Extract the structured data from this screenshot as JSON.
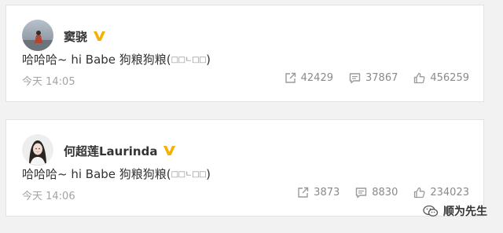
{
  "posts": [
    {
      "author": "窦骁",
      "text_main": "哈哈哈~ hi Babe 狗粮狗粮(",
      "text_emoticon": "□□ㄴ□□",
      "text_close": ")",
      "timestamp": "今天 14:05",
      "reposts": "42429",
      "comments": "37867",
      "likes": "456259"
    },
    {
      "author": "何超莲Laurinda",
      "text_main": "哈哈哈~ hi Babe 狗粮狗粮(",
      "text_emoticon": "□□ㄴ□□",
      "text_close": ")",
      "timestamp": "今天 14:06",
      "reposts": "3873",
      "comments": "8830",
      "likes": "234023"
    }
  ],
  "watermark": {
    "text": "顺为先生",
    "icon": "wechat-icon"
  },
  "icons": {
    "verified": "verified-badge-icon",
    "repost": "repost-icon",
    "comment": "comment-icon",
    "like": "like-icon"
  },
  "colors": {
    "verified_gold": "#f5b100",
    "text": "#333333",
    "meta": "#8a8a8a"
  }
}
